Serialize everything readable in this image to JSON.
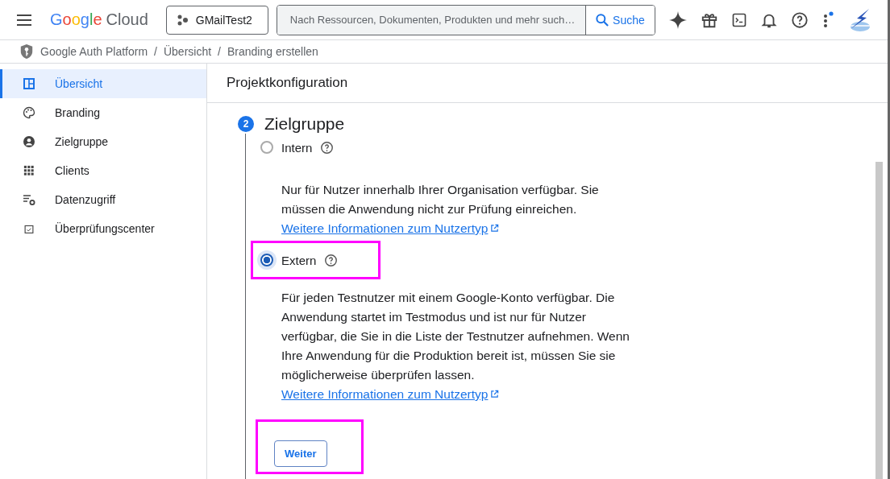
{
  "topbar": {
    "logo": [
      "Google",
      "Cloud"
    ],
    "project": "GMailTest2",
    "search": {
      "placeholder": "Nach Ressourcen, Dokumenten, Produkten und mehr such…"
    },
    "search_button": "Suche",
    "notification_dot": true
  },
  "breadcrumb": [
    "Google Auth Platform",
    "/",
    "Übersicht",
    "/",
    "Branding erstellen"
  ],
  "sidebar": {
    "items": [
      {
        "label": "Übersicht",
        "selected": true
      },
      {
        "label": "Branding",
        "selected": false
      },
      {
        "label": "Zielgruppe",
        "selected": false
      },
      {
        "label": "Clients",
        "selected": false
      },
      {
        "label": "Datenzugriff",
        "selected": false
      },
      {
        "label": "Überprüfungscenter",
        "selected": false
      }
    ]
  },
  "page": {
    "title": "Projektkonfiguration",
    "step": {
      "number": "2",
      "title": "Zielgruppe",
      "options": [
        {
          "label": "Intern",
          "selected": false,
          "highlighted": false,
          "description": "Nur für Nutzer innerhalb Ihrer Organisation verfügbar. Sie müssen die Anwendung nicht zur Prüfung einreichen.",
          "link": "Weitere Informationen zum Nutzertyp"
        },
        {
          "label": "Extern",
          "selected": true,
          "highlighted": true,
          "description": "Für jeden Testnutzer mit einem Google-Konto verfügbar. Die Anwendung startet im Testmodus und ist nur für Nutzer verfügbar, die Sie in die Liste der Testnutzer aufnehmen. Wenn Ihre Anwendung für die Produktion bereit ist, müssen Sie sie möglicherweise überprüfen lassen.",
          "link": "Weitere Informationen zum Nutzertyp"
        }
      ],
      "button": {
        "label": "Weiter",
        "highlighted": true
      }
    }
  }
}
